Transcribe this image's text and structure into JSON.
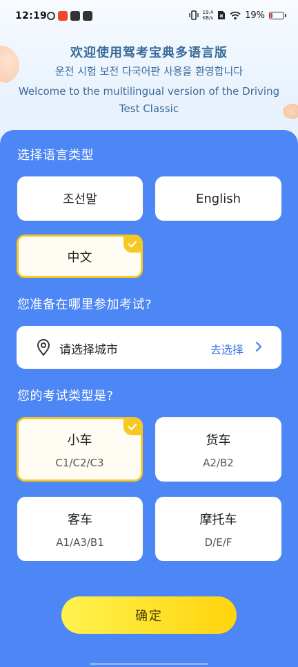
{
  "status_bar": {
    "time": "12:19",
    "net_speed": "19.4",
    "net_unit": "KB/s",
    "battery": "19%",
    "battery_level": 0.19,
    "app_icons": [
      "link-icon",
      "app-red-icon",
      "mail-icon",
      "play-store-icon"
    ]
  },
  "header": {
    "title_zh": "欢迎使用驾考宝典多语言版",
    "title_ko": "운전 시험 보전 다국어판 사용을 환영합니다",
    "title_en": "Welcome to the multilingual version of the Driving Test Classic"
  },
  "language": {
    "title": "选择语言类型",
    "options": [
      {
        "label": "조선말",
        "selected": false
      },
      {
        "label": "English",
        "selected": false
      },
      {
        "label": "中文",
        "selected": true
      }
    ]
  },
  "location": {
    "title": "您准备在哪里参加考试?",
    "placeholder": "请选择城市",
    "action": "去选择"
  },
  "exam": {
    "title": "您的考试类型是?",
    "options": [
      {
        "label": "小车",
        "code": "C1/C2/C3",
        "selected": true
      },
      {
        "label": "货车",
        "code": "A2/B2",
        "selected": false
      },
      {
        "label": "客车",
        "code": "A1/A3/B1",
        "selected": false
      },
      {
        "label": "摩托车",
        "code": "D/E/F",
        "selected": false
      }
    ]
  },
  "confirm_label": "确定",
  "colors": {
    "panel": "#4d86f5",
    "accent_yellow": "#f5c823",
    "link_blue": "#3e78e6",
    "header_text": "#3a6b9a"
  }
}
